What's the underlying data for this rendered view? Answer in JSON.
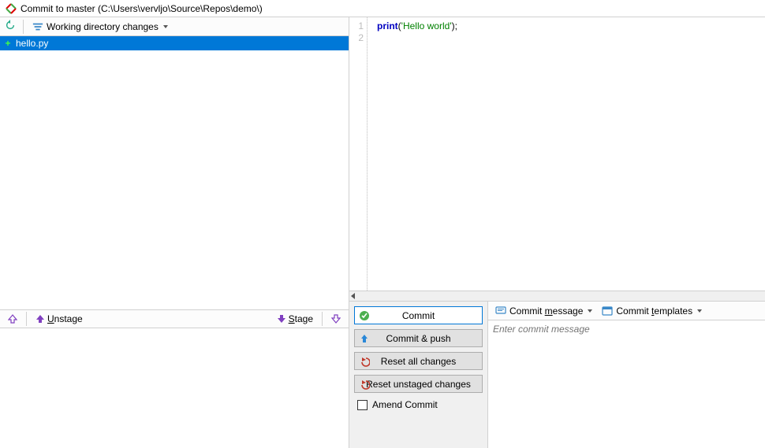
{
  "title": "Commit to master (C:\\Users\\vervljo\\Source\\Repos\\demo\\)",
  "workingChangesLabel": "Working directory changes",
  "files": [
    {
      "name": "hello.py",
      "status": "added",
      "selected": true
    }
  ],
  "unstageLabel": "Unstage",
  "stageLabel": "Stage",
  "code": {
    "lineNumbers": [
      "1",
      "2"
    ],
    "tokens": {
      "keyword": "print",
      "paren_open": "(",
      "string": "'Hello world'",
      "paren_close": ")",
      "semicolon": ";"
    }
  },
  "commitButtons": {
    "commit": "Commit",
    "commitPush": "Commit & push",
    "resetAll": "Reset all changes",
    "resetUnstaged": "Reset unstaged changes",
    "amend": "Amend Commit"
  },
  "messageToolbar": {
    "commitMessage_pre": "Commit ",
    "commitMessage_u": "m",
    "commitMessage_post": "essage",
    "commitTemplates_pre": "Commit ",
    "commitTemplates_u": "t",
    "commitTemplates_post": "emplates"
  },
  "commitMessagePlaceholder": "Enter commit message",
  "unstage_u": "U",
  "unstage_post": "nstage",
  "stage_u": "S",
  "stage_post": "tage"
}
